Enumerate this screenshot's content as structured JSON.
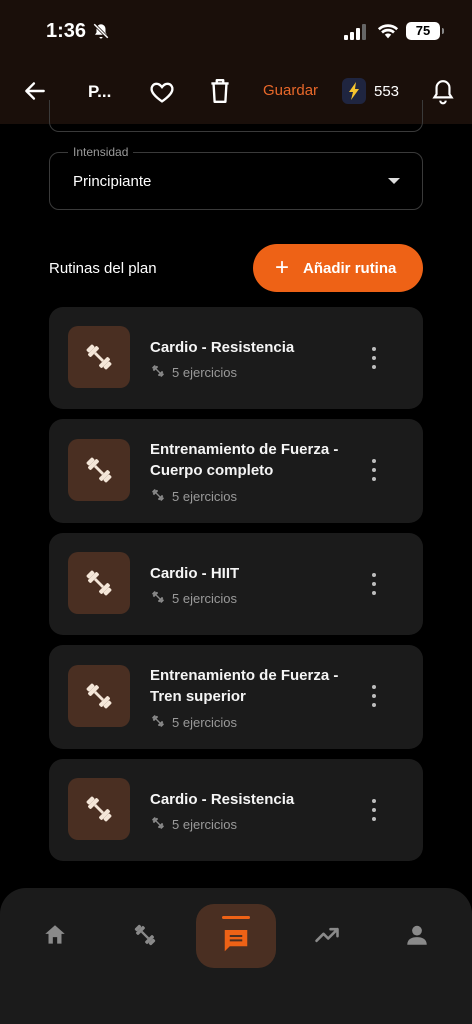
{
  "status_bar": {
    "time": "1:36",
    "battery": "75"
  },
  "header": {
    "title": "P...",
    "save_label": "Guardar",
    "credits": "553"
  },
  "form": {
    "intensity_label": "Intensidad",
    "intensity_value": "Principiante"
  },
  "routines_section": {
    "label": "Rutinas del plan",
    "add_label": "Añadir rutina"
  },
  "routines": [
    {
      "title": "Cardio - Resistencia",
      "meta": "5 ejercicios"
    },
    {
      "title": "Entrenamiento de Fuerza - Cuerpo completo",
      "meta": "5 ejercicios"
    },
    {
      "title": "Cardio - HIIT",
      "meta": "5 ejercicios"
    },
    {
      "title": "Entrenamiento de Fuerza - Tren superior",
      "meta": "5 ejercicios"
    },
    {
      "title": "Cardio - Resistencia",
      "meta": "5 ejercicios"
    }
  ],
  "nav": {
    "items": [
      "home-icon",
      "dumbbell-icon",
      "chat-icon",
      "trending-icon",
      "person-icon"
    ],
    "active": "chat-icon"
  },
  "colors": {
    "accent": "#ee6216",
    "card": "#1b1b1b",
    "thumb": "#4a2f22"
  }
}
